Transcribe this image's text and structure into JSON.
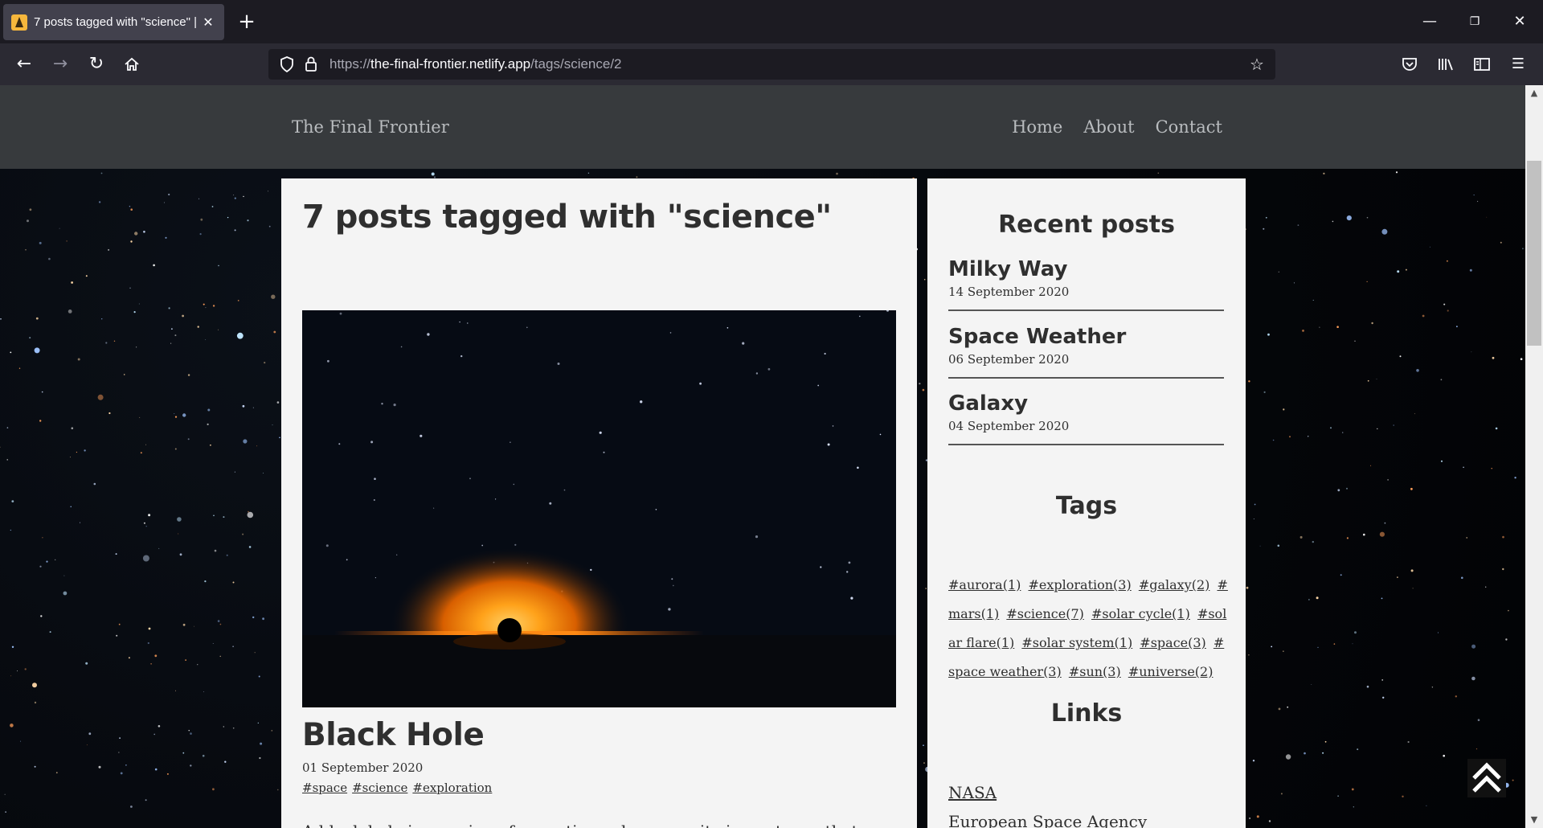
{
  "browser": {
    "tab_title": "7 posts tagged with \"science\" |",
    "url_scheme": "https://",
    "url_host": "the-final-frontier.netlify.app",
    "url_path": "/tags/science/2"
  },
  "site": {
    "brand": "The Final Frontier",
    "nav": [
      "Home",
      "About",
      "Contact"
    ]
  },
  "main": {
    "heading": "7 posts tagged with \"science\"",
    "post": {
      "title": "Black Hole",
      "date": "01 September 2020",
      "tags": [
        "#space",
        "#science",
        "#exploration"
      ],
      "excerpt": "A black hole is a region of spacetime where gravity is so strong that"
    }
  },
  "sidebar": {
    "recent_heading": "Recent posts",
    "recent": [
      {
        "title": "Milky Way",
        "date": "14 September 2020"
      },
      {
        "title": "Space Weather",
        "date": "06 September 2020"
      },
      {
        "title": "Galaxy",
        "date": "04 September 2020"
      }
    ],
    "tags_heading": "Tags",
    "tags": [
      "#aurora(1)",
      "#exploration(3)",
      "#galaxy(2)",
      "#mars(1)",
      "#science(7)",
      "#solar cycle(1)",
      "#solar flare(1)",
      "#solar system(1)",
      "#space(3)",
      "#space weather(3)",
      "#sun(3)",
      "#universe(2)"
    ],
    "links_heading": "Links",
    "links": [
      "NASA",
      "European Space Agency"
    ]
  },
  "icons": {
    "back": "arrow-left-icon",
    "forward": "arrow-right-icon",
    "reload": "reload-icon",
    "home": "home-icon",
    "shield": "shield-icon",
    "lock": "lock-icon",
    "bookmark": "star-icon",
    "pocket": "pocket-icon",
    "library": "library-icon",
    "sidebar": "sidebar-icon",
    "menu": "hamburger-icon",
    "back_to_top": "double-chevron-up-icon"
  }
}
